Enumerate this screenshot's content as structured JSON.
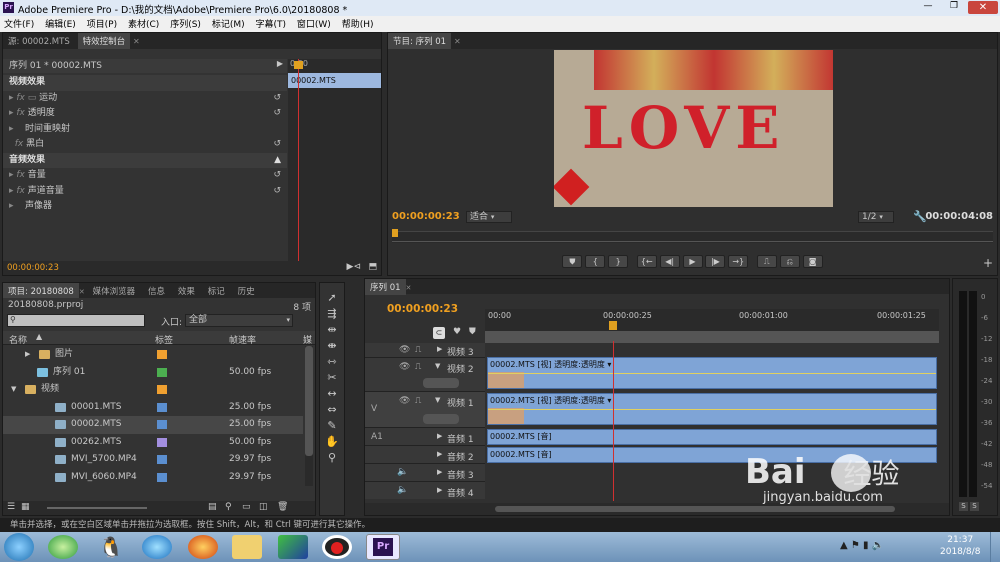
{
  "window": {
    "title": "Adobe Premiere Pro - D:\\我的文档\\Adobe\\Premiere Pro\\6.0\\20180808 *",
    "app_badge": "Pr"
  },
  "menu": [
    "文件(F)",
    "编辑(E)",
    "项目(P)",
    "素材(C)",
    "序列(S)",
    "标记(M)",
    "字幕(T)",
    "窗口(W)",
    "帮助(H)"
  ],
  "effect_controls": {
    "tabs": [
      "源: 00002.MTS",
      "特效控制台"
    ],
    "header": "序列 01 * 00002.MTS",
    "ruler_start": "0:00",
    "clip_label": "00002.MTS",
    "video_section": "视频效果",
    "video_effects": [
      "运动",
      "透明度",
      "时间重映射",
      "黑白"
    ],
    "audio_section": "音频效果",
    "audio_effects": [
      "音量",
      "声道音量",
      "声像器"
    ],
    "timecode": "00:00:00:23"
  },
  "program": {
    "tab": "节目: 序列 01",
    "timecode_left": "00:00:00:23",
    "fit": "适合",
    "quality": "1/2",
    "timecode_right": "00:00:04:08",
    "image_text": "LOVE"
  },
  "project": {
    "tabs": [
      "项目: 20180808",
      "媒体浏览器",
      "信息",
      "效果",
      "标记",
      "历史"
    ],
    "file": "20180808.prproj",
    "count": "8 项",
    "in_label": "入口:",
    "in_value": "全部",
    "columns": [
      "名称",
      "标签",
      "帧速率",
      "媒"
    ],
    "items": [
      {
        "name": "图片",
        "type": "folder",
        "color": "#f0a030",
        "fps": ""
      },
      {
        "name": "序列 01",
        "type": "sequence",
        "color": "#4caf50",
        "fps": "50.00 fps"
      },
      {
        "name": "视频",
        "type": "folder",
        "color": "#f0a030",
        "fps": ""
      },
      {
        "name": "00001.MTS",
        "type": "clip",
        "color": "#5b8fd0",
        "fps": "25.00 fps"
      },
      {
        "name": "00002.MTS",
        "type": "clip",
        "color": "#5b8fd0",
        "fps": "25.00 fps"
      },
      {
        "name": "00262.MTS",
        "type": "clip",
        "color": "#a38fe0",
        "fps": "50.00 fps"
      },
      {
        "name": "MVI_5700.MP4",
        "type": "clip",
        "color": "#5b8fd0",
        "fps": "29.97 fps"
      },
      {
        "name": "MVI_6060.MP4",
        "type": "clip",
        "color": "#5b8fd0",
        "fps": "29.97 fps"
      }
    ]
  },
  "timeline": {
    "tab": "序列 01",
    "timecode": "00:00:00:23",
    "ruler": [
      "00:00",
      "00:00:00:25",
      "00:00:01:00",
      "00:00:01:25"
    ],
    "tracks": [
      "视频 3",
      "视频 2",
      "视频 1",
      "音频 1",
      "音频 2",
      "音频 3",
      "音频 4"
    ],
    "v_label": "V",
    "a_label": "A1",
    "clip_v2": "00002.MTS [视] 透明度:透明度 ▾",
    "clip_v1": "00002.MTS [视] 透明度:透明度 ▾",
    "clip_a1": "00002.MTS [音]",
    "clip_a2": "00002.MTS [音]"
  },
  "meter": {
    "scale": [
      "0",
      "-6",
      "-12",
      "-18",
      "-24",
      "-30",
      "-36",
      "-42",
      "-48",
      "-54"
    ],
    "buttons": [
      "S",
      "S"
    ]
  },
  "status": "单击并选择，或在空白区域单击并拖拉为选取框。按住 Shift，Alt，和 Ctrl 键可进行其它操作。",
  "taskbar": {
    "time": "21:37",
    "date": "2018/8/8"
  },
  "watermark": {
    "brand": "Bai",
    "suffix": "经验",
    "url": "jingyan.baidu.com"
  }
}
